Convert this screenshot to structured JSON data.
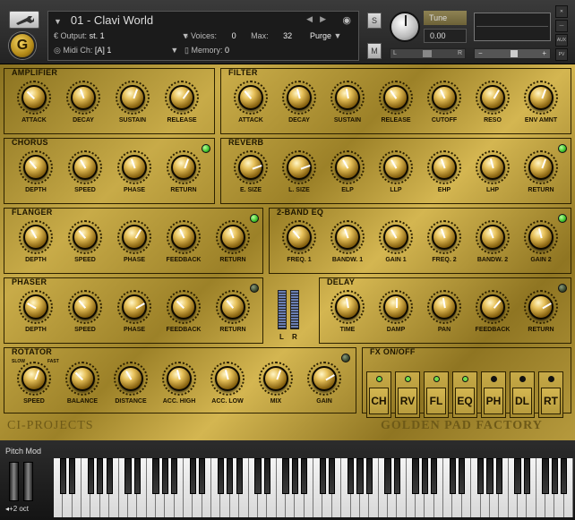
{
  "header": {
    "instrument_name": "01 - Clavi World",
    "output_label": "Output:",
    "output_value": "st. 1",
    "voices_label": "Voices:",
    "voices_value": "0",
    "max_label": "Max:",
    "max_value": "32",
    "purge_label": "Purge",
    "midi_label": "Midi Ch:",
    "midi_value": "[A] 1",
    "memory_label": "Memory:",
    "memory_value": "0",
    "solo_label": "S",
    "mute_label": "M",
    "tune_label": "Tune",
    "tune_value": "0.00",
    "pan_left": "L",
    "pan_right": "R",
    "aux_label": "AUX",
    "pv_label": "PV",
    "logo_letter": "G"
  },
  "sections": {
    "amplifier": {
      "title": "AMPLIFIER",
      "knobs": [
        "ATTACK",
        "DECAY",
        "SUSTAIN",
        "RELEASE"
      ]
    },
    "filter": {
      "title": "FILTER",
      "knobs": [
        "ATTACK",
        "DECAY",
        "SUSTAIN",
        "RELEASE",
        "CUTOFF",
        "RESO",
        "ENV AMNT"
      ]
    },
    "chorus": {
      "title": "CHORUS",
      "knobs": [
        "DEPTH",
        "SPEED",
        "PHASE",
        "RETURN"
      ]
    },
    "reverb": {
      "title": "REVERB",
      "knobs": [
        "E. SIZE",
        "L. SIZE",
        "ELP",
        "LLP",
        "EHP",
        "LHP",
        "RETURN"
      ]
    },
    "flanger": {
      "title": "FLANGER",
      "knobs": [
        "DEPTH",
        "SPEED",
        "PHASE",
        "FEEDBACK",
        "RETURN"
      ]
    },
    "eq": {
      "title": "2-BAND EQ",
      "knobs": [
        "FREQ. 1",
        "BANDW. 1",
        "GAIN 1",
        "FREQ. 2",
        "BANDW. 2",
        "GAIN 2"
      ]
    },
    "phaser": {
      "title": "PHASER",
      "knobs": [
        "DEPTH",
        "SPEED",
        "PHASE",
        "FEEDBACK",
        "RETURN"
      ]
    },
    "delay": {
      "title": "DELAY",
      "knobs": [
        "TIME",
        "DAMP",
        "PAN",
        "FEEDBACK",
        "RETURN"
      ]
    },
    "rotator": {
      "title": "ROTATOR",
      "knobs": [
        "SPEED",
        "BALANCE",
        "DISTANCE",
        "ACC. HIGH",
        "ACC. LOW",
        "MIX",
        "GAIN"
      ],
      "slow_label": "SLOW",
      "fast_label": "FAST"
    },
    "fx": {
      "title": "FX ON/OFF",
      "buttons": [
        "CH",
        "RV",
        "FL",
        "EQ",
        "PH",
        "DL",
        "RT"
      ],
      "states": [
        true,
        true,
        true,
        true,
        false,
        false,
        false
      ]
    }
  },
  "vu": {
    "left": "L",
    "right": "R"
  },
  "branding": {
    "left": "CI-PROJECTS",
    "right": "GOLDEN PAD FACTORY"
  },
  "keyboard": {
    "pitch_mod_label": "Pitch Mod",
    "octave_label": "+2 oct"
  },
  "colors": {
    "gold": "#c8ab48",
    "led_on": "#3dc02b",
    "header_bg": "#2c2c2c"
  }
}
